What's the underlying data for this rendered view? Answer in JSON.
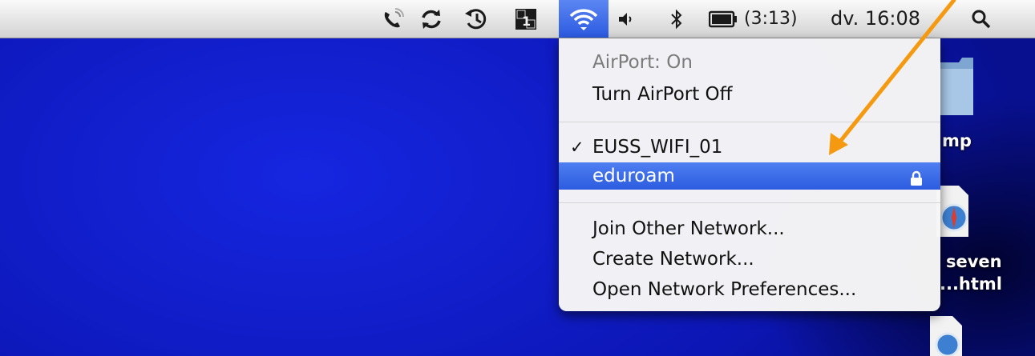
{
  "menubar": {
    "battery_time": "(3:13)",
    "clock": "dv. 16:08",
    "icons": [
      "phone-icon",
      "sync-icon",
      "time-machine-icon",
      "spaces-icon",
      "wifi-icon",
      "volume-icon",
      "bluetooth-icon",
      "battery-icon",
      "spotlight-icon"
    ]
  },
  "wifi_menu": {
    "status": "AirPort: On",
    "toggle": "Turn AirPort Off",
    "networks": [
      {
        "name": "EUSS_WIFI_01",
        "checked": true,
        "locked": false
      },
      {
        "name": "eduroam",
        "checked": false,
        "locked": true,
        "highlighted": true
      }
    ],
    "join_other": "Join Other Network...",
    "create": "Create Network...",
    "preferences": "Open Network Preferences..."
  },
  "desktop": {
    "labels": [
      "mp",
      "seven",
      "...html"
    ]
  },
  "colors": {
    "highlight": "#2c5be0",
    "arrow": "#f59a10",
    "desktop": "#1626e0"
  }
}
